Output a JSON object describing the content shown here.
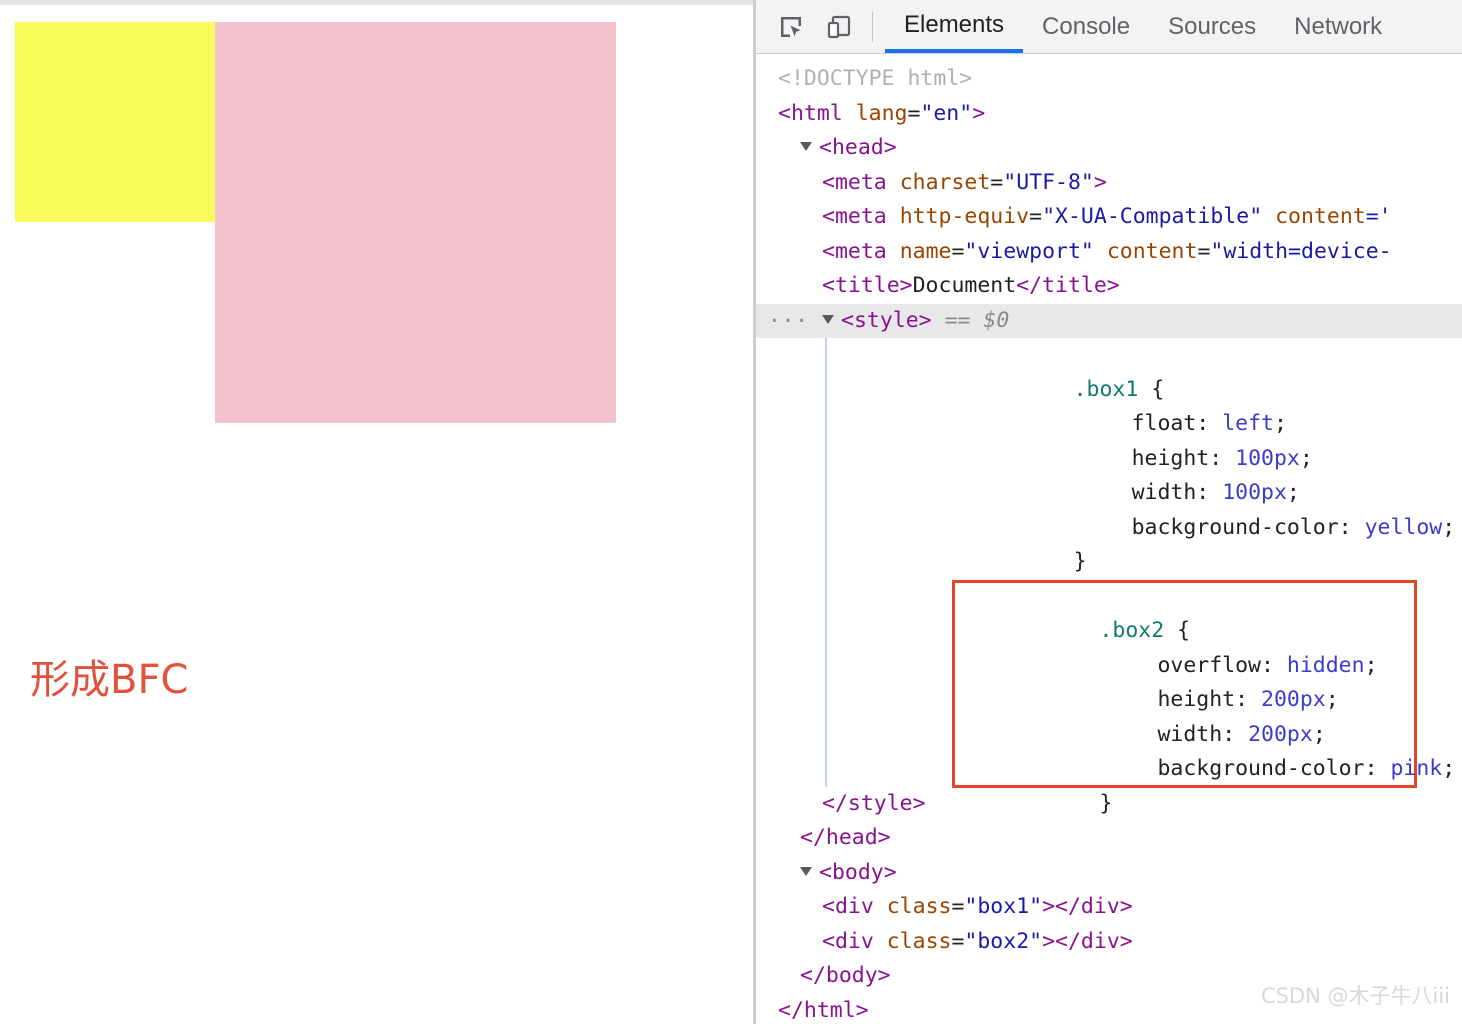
{
  "viewport": {
    "box1": {
      "name": "box1",
      "color": "#fafa5a"
    },
    "box2": {
      "name": "box2",
      "color": "#f5c3ce"
    },
    "annotation": "形成BFC",
    "annotation_color": "#e0523c"
  },
  "devtools": {
    "toolbar": {
      "inspect_icon": "inspect-element-icon",
      "device_icon": "device-toolbar-icon"
    },
    "tabs": [
      {
        "label": "Elements",
        "active": true
      },
      {
        "label": "Console",
        "active": false
      },
      {
        "label": "Sources",
        "active": false
      },
      {
        "label": "Network",
        "active": false
      }
    ],
    "accent_color": "#1a73e8",
    "highlight_border_color": "#e0442a",
    "dom": {
      "doctype": "<!DOCTYPE html>",
      "html_open_tag": "<html",
      "html_attr_name": "lang",
      "html_attr_value": "\"en\"",
      "html_close_bracket": ">",
      "head_open": "<head>",
      "meta_charset": "<meta charset=\"UTF-8\">",
      "meta_charset_tag": "<meta",
      "meta_charset_attr": "charset",
      "meta_charset_val": "\"UTF-8\"",
      "meta_compat_attr1": "http-equiv",
      "meta_compat_val1": "\"X-UA-Compatible\"",
      "meta_compat_attr2": "content",
      "meta_compat_val2": "='",
      "meta_viewport_attr1": "name",
      "meta_viewport_val1": "\"viewport\"",
      "meta_viewport_attr2": "content",
      "meta_viewport_val2": "\"width=device-",
      "title_open": "<title>",
      "title_text": "Document",
      "title_close": "</title>",
      "style_dots": "···",
      "style_open": "<style>",
      "style_equals": "==",
      "style_dollar": "$0",
      "style_close": "</style>",
      "head_close": "</head>",
      "body_open": "<body>",
      "div_box1": {
        "open": "<div",
        "attr": "class",
        "value": "\"box1\"",
        "close_bracket": ">",
        "close_tag": "</div>"
      },
      "div_box2": {
        "open": "<div",
        "attr": "class",
        "value": "\"box2\"",
        "close_bracket": ">",
        "close_tag": "</div>"
      },
      "body_close": "</body>",
      "html_close": "</html>"
    },
    "css": {
      "box1_rule": {
        "selector": ".box1",
        "open_brace": "{",
        "declarations": [
          {
            "prop": "float",
            "value": "left"
          },
          {
            "prop": "height",
            "value": "100px"
          },
          {
            "prop": "width",
            "value": "100px"
          },
          {
            "prop": "background-color",
            "value": "yellow"
          }
        ],
        "close_brace": "}"
      },
      "box2_rule": {
        "selector": ".box2",
        "open_brace": "{",
        "highlighted": true,
        "declarations": [
          {
            "prop": "overflow",
            "value": "hidden"
          },
          {
            "prop": "height",
            "value": "200px"
          },
          {
            "prop": "width",
            "value": "200px"
          },
          {
            "prop": "background-color",
            "value": "pink"
          }
        ],
        "close_brace": "}"
      }
    }
  },
  "watermark": "CSDN @木子牛八iii"
}
